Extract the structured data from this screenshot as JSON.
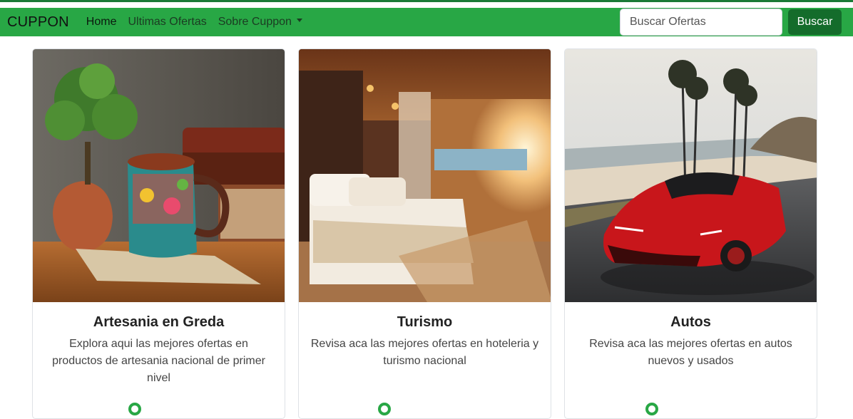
{
  "navbar": {
    "brand": "CUPPON",
    "links": [
      {
        "label": "Home"
      },
      {
        "label": "Ultimas Ofertas"
      },
      {
        "label": "Sobre Cuppon"
      }
    ],
    "search_placeholder": "Buscar Ofertas",
    "search_button": "Buscar"
  },
  "cards": [
    {
      "title": "Artesania en Greda",
      "text": "Explora aqui las mejores ofertas en productos de artesania nacional de primer nivel"
    },
    {
      "title": "Turismo",
      "text": "Revisa aca las mejores ofertas en hoteleria y turismo nacional"
    },
    {
      "title": "Autos",
      "text": "Revisa aca las mejores ofertas en autos nuevos y usados"
    }
  ],
  "colors": {
    "navbar": "#28a745",
    "button": "#146c2b",
    "accent": "#28a745"
  }
}
